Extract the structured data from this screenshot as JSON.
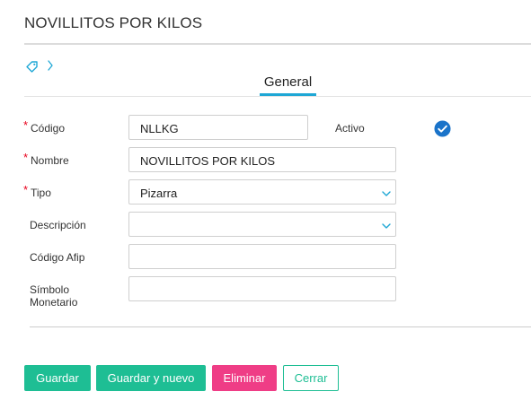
{
  "header": {
    "title": "NOVILLITOS POR KILOS"
  },
  "breadcrumb": {
    "icons": [
      "tag-icon",
      "chevron-right-icon"
    ]
  },
  "tabs": [
    {
      "label": "General",
      "active": true
    }
  ],
  "form": {
    "codigo": {
      "label": "Código",
      "required": true,
      "value": "NLLKG"
    },
    "activo": {
      "label": "Activo",
      "checked": true
    },
    "nombre": {
      "label": "Nombre",
      "required": true,
      "value": "NOVILLITOS POR KILOS"
    },
    "tipo": {
      "label": "Tipo",
      "required": true,
      "value": "Pizarra"
    },
    "descripcion": {
      "label": "Descripción",
      "required": false,
      "value": ""
    },
    "codigo_afip": {
      "label": "Código Afip",
      "required": false,
      "value": ""
    },
    "simbolo_monetario": {
      "label_line1": "Símbolo",
      "label_line2": "Monetario",
      "required": false,
      "value": ""
    },
    "required_mark": "*"
  },
  "actions": {
    "guardar": "Guardar",
    "guardar_y_nuevo": "Guardar y nuevo",
    "eliminar": "Eliminar",
    "cerrar": "Cerrar"
  },
  "colors": {
    "accent_green": "#1ebe94",
    "danger_pink": "#ef3d86",
    "tab_underline": "#1ea7d5",
    "check_blue": "#1a73c9",
    "required_red": "#e8001c"
  }
}
